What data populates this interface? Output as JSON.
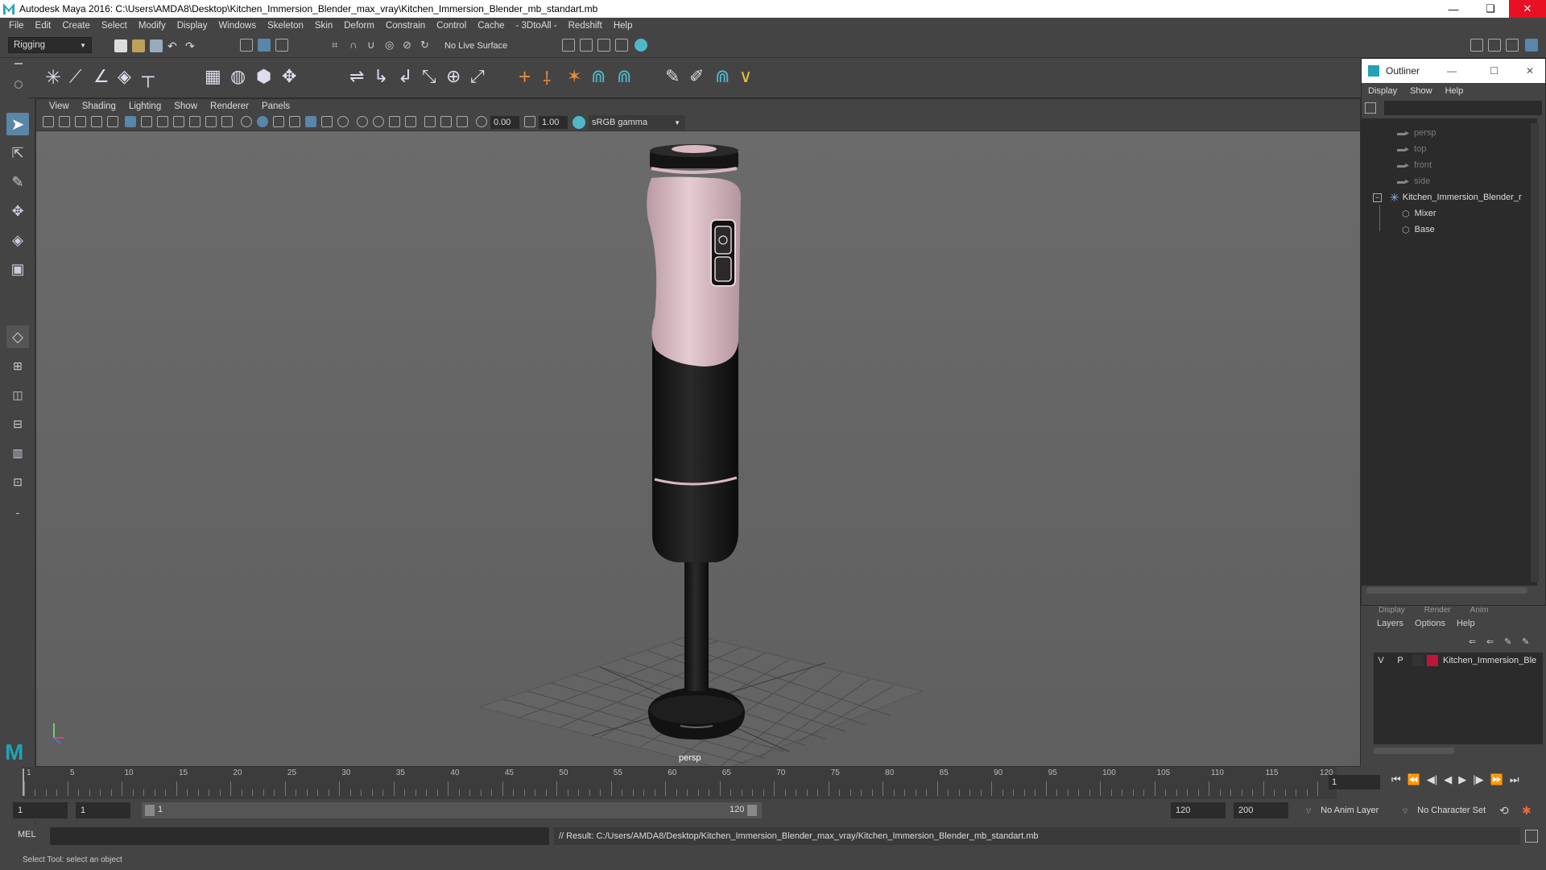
{
  "window": {
    "title": "Autodesk Maya 2016: C:\\Users\\AMDA8\\Desktop\\Kitchen_Immersion_Blender_max_vray\\Kitchen_Immersion_Blender_mb_standart.mb",
    "minimize": "—",
    "restore": "❏",
    "close": "✕"
  },
  "menubar": [
    "File",
    "Edit",
    "Create",
    "Select",
    "Modify",
    "Display",
    "Windows",
    "Skeleton",
    "Skin",
    "Deform",
    "Constrain",
    "Control",
    "Cache",
    "- 3DtoAll -",
    "Redshift",
    "Help"
  ],
  "statusline": {
    "mode": "Rigging",
    "live_surface": "No Live Surface"
  },
  "viewport": {
    "menu": [
      "View",
      "Shading",
      "Lighting",
      "Show",
      "Renderer",
      "Panels"
    ],
    "exposure": "0.00",
    "gamma": "1.00",
    "color_space": "sRGB gamma",
    "camera_label": "persp"
  },
  "outliner": {
    "title": "Outliner",
    "menu": [
      "Display",
      "Show",
      "Help"
    ],
    "items": [
      {
        "label": "persp",
        "type": "camera",
        "dim": true
      },
      {
        "label": "top",
        "type": "camera",
        "dim": true
      },
      {
        "label": "front",
        "type": "camera",
        "dim": true
      },
      {
        "label": "side",
        "type": "camera",
        "dim": true
      },
      {
        "label": "Kitchen_Immersion_Blender_r",
        "type": "group",
        "dim": false
      },
      {
        "label": "Mixer",
        "type": "mesh",
        "dim": false
      },
      {
        "label": "Base",
        "type": "mesh",
        "dim": false
      }
    ]
  },
  "layers": {
    "tabs": [
      "Display",
      "Render",
      "Anim"
    ],
    "menu": [
      "Layers",
      "Options",
      "Help"
    ],
    "layer_v": "V",
    "layer_p": "P",
    "layer_name": "Kitchen_Immersion_Ble",
    "layer_color": "#c0143c"
  },
  "timeline": {
    "ticks": [
      "1",
      "5",
      "10",
      "15",
      "20",
      "25",
      "30",
      "35",
      "40",
      "45",
      "50",
      "55",
      "60",
      "65",
      "70",
      "75",
      "80",
      "85",
      "90",
      "95",
      "100",
      "105",
      "110",
      "115",
      "120"
    ],
    "current_frame": "1"
  },
  "range": {
    "start": "1",
    "playback_start": "1",
    "slider_start": "1",
    "slider_end": "120",
    "playback_end": "120",
    "end": "200",
    "anim_layer": "No Anim Layer",
    "char_set": "No Character Set"
  },
  "cmdline": {
    "lang": "MEL",
    "result": "// Result: C:/Users/AMDA8/Desktop/Kitchen_Immersion_Blender_max_vray/Kitchen_Immersion_Blender_mb_standart.mb"
  },
  "helpline": "Select Tool: select an object",
  "colors": {
    "accent": "#5a86a8",
    "blender_pink": "#d9b8c0",
    "blender_black": "#1a1a1a"
  }
}
